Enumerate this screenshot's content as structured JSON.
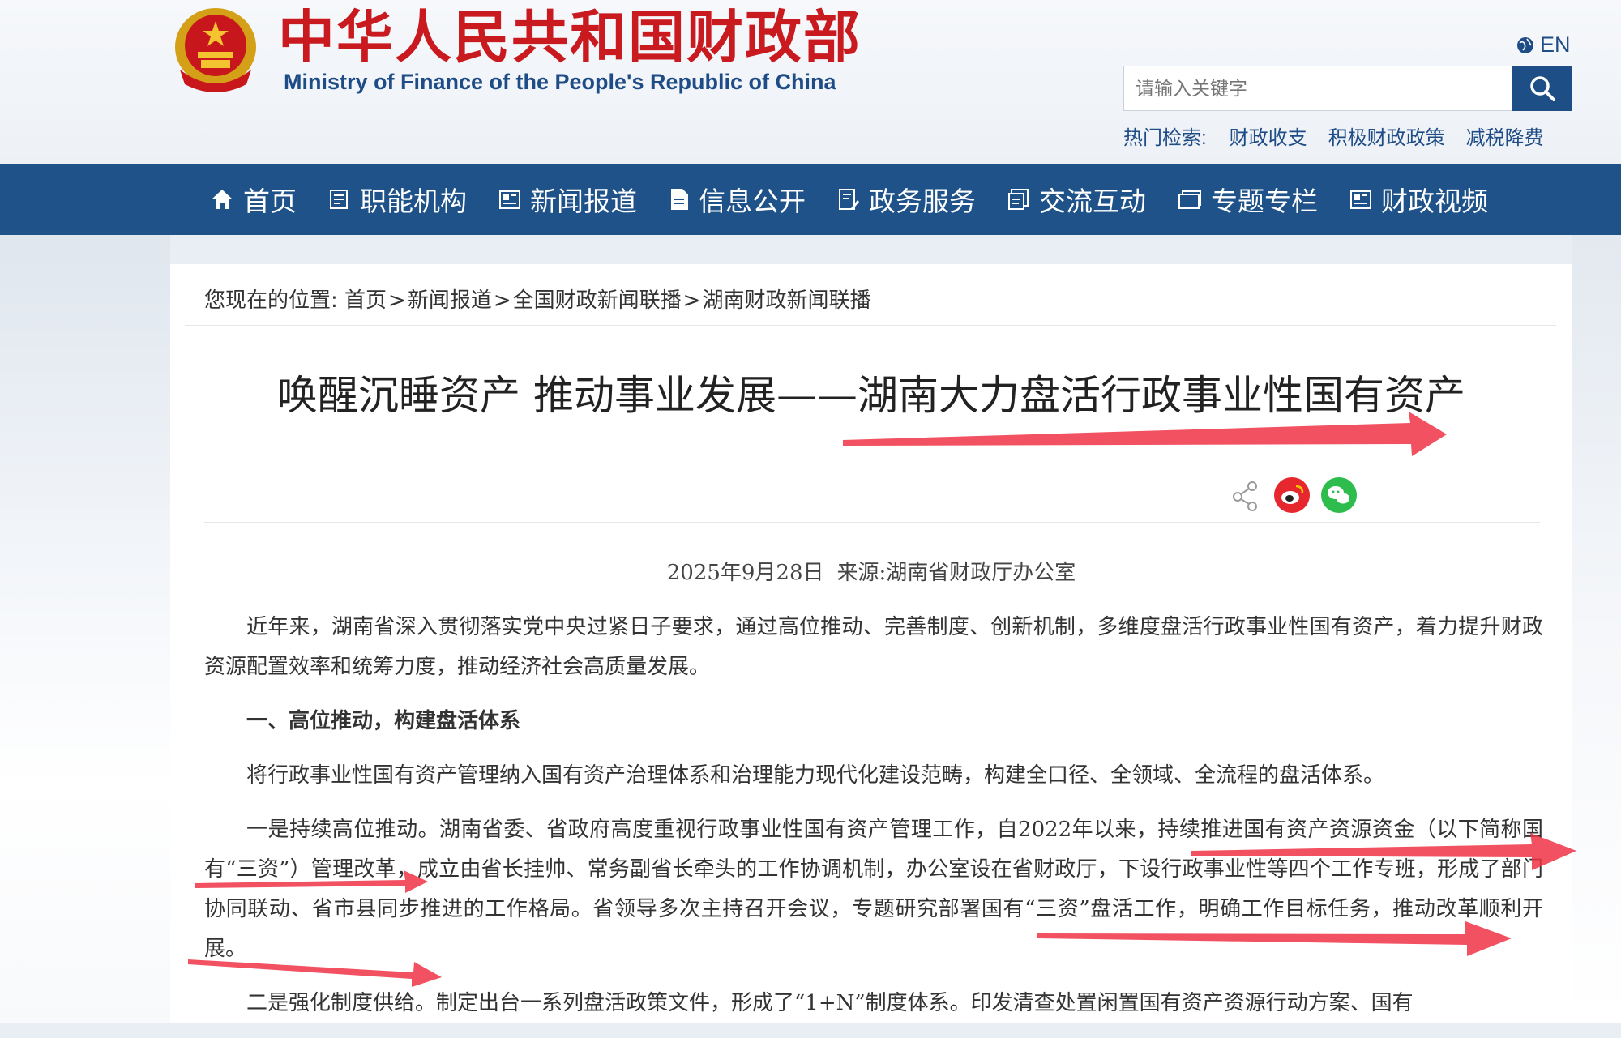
{
  "header": {
    "title": "中华人民共和国财政部",
    "subtitle": "Ministry of Finance of the People's Republic of China",
    "lang_label": "EN",
    "search_placeholder": "请输入关键字",
    "hot_label": "热门检索:",
    "hot_links": [
      "财政收支",
      "积极财政政策",
      "减税降费"
    ]
  },
  "nav": [
    {
      "label": "首页",
      "icon": "home-icon"
    },
    {
      "label": "职能机构",
      "icon": "list-icon"
    },
    {
      "label": "新闻报道",
      "icon": "news-icon"
    },
    {
      "label": "信息公开",
      "icon": "document-icon"
    },
    {
      "label": "政务服务",
      "icon": "edit-doc-icon"
    },
    {
      "label": "交流互动",
      "icon": "chat-icon"
    },
    {
      "label": "专题专栏",
      "icon": "folder-icon"
    },
    {
      "label": "财政视频",
      "icon": "video-icon"
    }
  ],
  "breadcrumb": {
    "label": "您现在的位置:",
    "items": [
      "首页",
      "新闻报道",
      "全国财政新闻联播",
      "湖南财政新闻联播"
    ],
    "separator": ">"
  },
  "article": {
    "title": "唤醒沉睡资产 推动事业发展——湖南大力盘活行政事业性国有资产",
    "date": "2025年9月28日",
    "source": "来源:湖南省财政厅办公室",
    "paragraphs": [
      "近年来，湖南省深入贯彻落实党中央过紧日子要求，通过高位推动、完善制度、创新机制，多维度盘活行政事业性国有资产，着力提升财政资源配置效率和统筹力度，推动经济社会高质量发展。",
      "一、高位推动，构建盘活体系",
      "将行政事业性国有资产管理纳入国有资产治理体系和治理能力现代化建设范畴，构建全口径、全领域、全流程的盘活体系。",
      "一是持续高位推动。湖南省委、省政府高度重视行政事业性国有资产管理工作，自2022年以来，持续推进国有资产资源资金（以下简称国有“三资”）管理改革，成立由省长挂帅、常务副省长牵头的工作协调机制，办公室设在省财政厅，下设行政事业性等四个工作专班，形成了部门协同联动、省市县同步推进的工作格局。省领导多次主持召开会议，专题研究部署国有“三资”盘活工作，明确工作目标任务，推动改革顺利开展。",
      "二是强化制度供给。制定出台一系列盘活政策文件，形成了“1+N”制度体系。印发清查处置闲置国有资产资源行动方案、国有"
    ]
  },
  "colors": {
    "brand_red": "#c81a1f",
    "nav_blue": "#1e5289",
    "arrow_red": "#ee3344"
  }
}
